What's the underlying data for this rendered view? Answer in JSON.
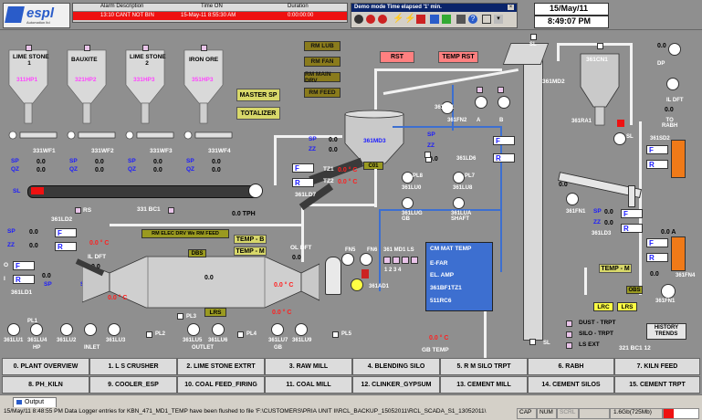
{
  "header": {
    "logo_text": "espl",
    "logo_sub": "Automation ltd",
    "alarm_cols": [
      "Alarm Description",
      "Time ON",
      "Duration"
    ],
    "alarm_row": [
      "13:10 CANT NOT BIN",
      "15-May-11 8:55:30 AM",
      "0:00:00:00"
    ],
    "demo_title": "Demo mode Time elapsed '1' min.",
    "date": "15/May/11",
    "time": "8:49:07 PM"
  },
  "hoppers": [
    {
      "name": "LIME STONE\n1",
      "tag": "311HP1"
    },
    {
      "name": "BAUXITE",
      "tag": "321HP2"
    },
    {
      "name": "LIME STONE\n2",
      "tag": "331HP3"
    },
    {
      "name": "IRON ORE",
      "tag": "351HP3"
    }
  ],
  "weighfeeders": [
    "331WF1",
    "331WF2",
    "331WF3",
    "331WF4"
  ],
  "buttons": {
    "master_sp": "MASTER SP",
    "totalizer": "TOTALIZER",
    "rst": "RST",
    "temp_rst": "TEMP RST",
    "rm_lub": "RM LUB",
    "rm_fan": "RM FAN",
    "rm_main_drv": "RM MAIN DRV",
    "rm_feed": "RM FEED",
    "cm_mat_temp": "CM MAT TEMP",
    "e_far": "E-FAR",
    "el_amp": "EL. AMP",
    "tag_361bf": "361BF1TZ1",
    "tag_511rc": "511RC6",
    "rm_elec_drv": "RM ELEC DRV  We  RM FEED",
    "lrs": "LRS",
    "lrc": "LRC",
    "lrs2": "LRS",
    "dbs": "DBS",
    "obs": "OBS",
    "temp_b": "TEMP - B",
    "temp_m": "TEMP - M",
    "temp_m2": "TEMP - M",
    "history": "HISTORY\nTRENDS",
    "c01": "C01"
  },
  "labels": {
    "sp": "SP",
    "qz": "QZ",
    "zz": "ZZ",
    "sl": "SL",
    "zero": "0.0",
    "zero_c": "0.0 ° C",
    "zero_c2": "0.0 ° C",
    "zero_c3": "0.0 ° C",
    "zero_c4": "0.0 ° C",
    "zero_c5": "0.0 ° C",
    "zero_c6": "0.0 ° C",
    "zero_c7": "0.0 ° C",
    "zero_tph": "0.0 TPH",
    "zero_a": "0.0 A",
    "bc1": "331 BC1",
    "rs": "RS",
    "fn2": "361FN2",
    "fn3": "361FN3",
    "fn5": "FN5",
    "fn6": "FN6",
    "md3": "361MD3",
    "md2": "361MD2",
    "bl1": "361BL1",
    "a": "A",
    "b": "B",
    "tz1": "TZ1",
    "tz2": "TZ2",
    "ld7": "361LD7",
    "ld2": "361LD2",
    "ld1": "361LD1",
    "ld3": "361LD3",
    "ld6": "361LD6",
    "lu0": "361LU0",
    "lu8": "361LU8",
    "lu_gb": "361LUG\nGB",
    "lu_shaft": "361LUA\nSHAFT",
    "pl8": "PL8",
    "pl7": "PL7",
    "pl1": "PL1",
    "pl2": "PL2",
    "pl3": "PL3",
    "pl4": "PL4",
    "pl5": "PL5",
    "il_dft": "IL DFT",
    "ol_dft": "OL DFT",
    "gb_temp": "GB TEMP",
    "ad1": "361AD1",
    "md1_ls": "361 MD1 LS",
    "nums": "1  2  3  4",
    "cn1": "361CN1",
    "ra1": "361RA1",
    "sd2": "361SD2",
    "dp": "DP",
    "il_dft2": "IL DFT",
    "to_rabh": "TO\nRABH",
    "fn1": "361FN1",
    "fn4": "361FN4",
    "bc12": "321 BC1 12",
    "dust_trpt": "DUST - TRPT",
    "silo_trpt": "SILO - TRPT",
    "ls_ext": "LS EXT",
    "inlet": "INLET",
    "outlet": "OUTLET",
    "hp": "HP",
    "lu1": "361LU1",
    "lu4": "361LU4",
    "lu2": "361LU2",
    "lu3": "361LU3",
    "lu5": "361LU5",
    "lu6": "361LU6",
    "lu7": "361LU7",
    "lu9": "361LU9",
    "gb": "GB",
    "f": "F",
    "r": "R",
    "o": "O",
    "i": "I"
  },
  "nav_row1": [
    "0. PLANT OVERVIEW",
    "1. L S CRUSHER",
    "2. LIME STONE EXTRT",
    "3. RAW MILL",
    "4. BLENDING SILO",
    "5. R M SILO TRPT",
    "6. RABH",
    "7. KILN FEED"
  ],
  "nav_row2": [
    "8. PH_KILN",
    "9. COOLER_ESP",
    "10. COAL FEED_FIRING",
    "11. COAL MILL",
    "12. CLINKER_GYPSUM",
    "13. CEMENT MILL",
    "14. CEMENT SILOS",
    "15. CEMENT TRPT"
  ],
  "footer": {
    "output_tab": "Output",
    "log_line": "15/May/11 8:48:55 PM Data Logger entries for KBN_471_MD1_TEMP have been flushed to file 'F:\\CUSTOMERS\\PRIA UNIT II\\RCL_BACKUP_15052011\\RCL_SCADA_S1_13052011\\",
    "cap": "CAP",
    "num": "NUM",
    "scrl": "SCRL",
    "mem": "1.6Gb(725Mb)"
  },
  "colors": {
    "bg": "#8f8f8f",
    "panel_dark": "#3a3a3a",
    "accent_red": "#ff2020",
    "accent_blue": "#1a1aff",
    "hopper_label": "#e6e6e6",
    "orange": "#f07a18"
  }
}
